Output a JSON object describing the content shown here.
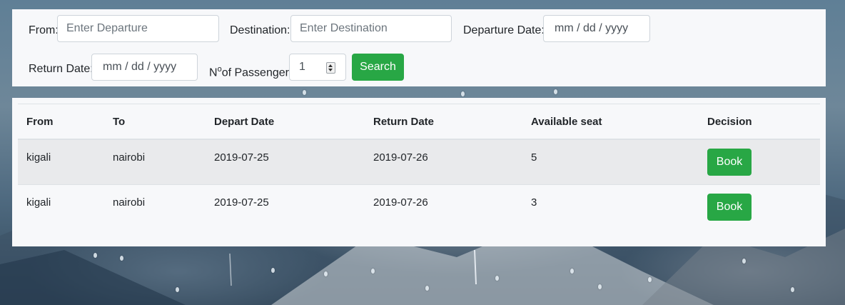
{
  "search": {
    "from_label": "From:",
    "from_placeholder": "Enter Departure",
    "destination_label": "Destination:",
    "destination_placeholder": "Enter Destination",
    "departure_date_label": "Departure Date:",
    "departure_date_placeholder": "mm / dd / yyyy",
    "return_date_label": "Return Date:",
    "return_date_placeholder": "mm / dd / yyyy",
    "passenger_label_prefix": "N",
    "passenger_label_sup": "o",
    "passenger_label_suffix": "of Passenger:",
    "passenger_value": "1",
    "search_button": "Search"
  },
  "table": {
    "headers": {
      "from": "From",
      "to": "To",
      "depart_date": "Depart Date",
      "return_date": "Return Date",
      "available_seat": "Available seat",
      "decision": "Decision"
    },
    "rows": [
      {
        "from": "kigali",
        "to": "nairobi",
        "depart_date": "2019-07-25",
        "return_date": "2019-07-26",
        "available_seat": "5",
        "action": "Book"
      },
      {
        "from": "kigali",
        "to": "nairobi",
        "depart_date": "2019-07-25",
        "return_date": "2019-07-26",
        "available_seat": "3",
        "action": "Book"
      }
    ]
  },
  "colors": {
    "accent_green": "#28a745",
    "panel_bg": "#f7f8fa",
    "striped_row": "#e9eaec"
  },
  "icons": {
    "number_spinner": "spinner-arrows-icon"
  }
}
